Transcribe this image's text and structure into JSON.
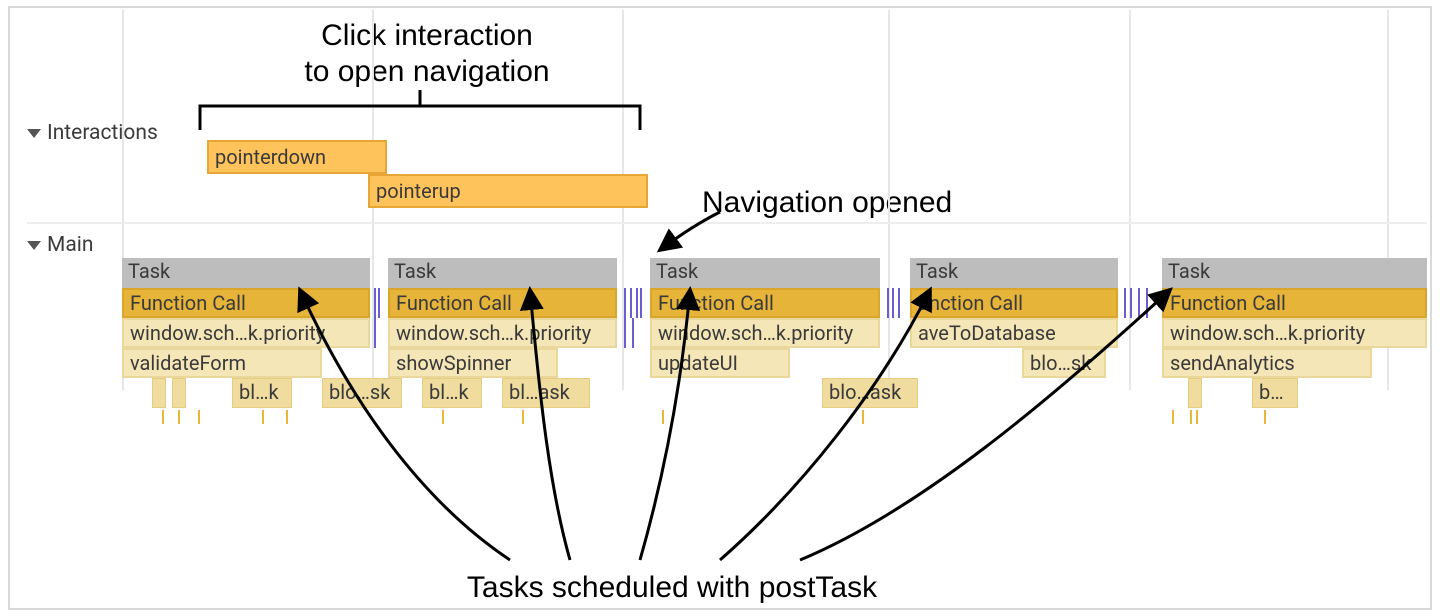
{
  "tracks": {
    "interactions_label": "Interactions",
    "main_label": "Main"
  },
  "interactions": {
    "row0": {
      "label": "pointerdown"
    },
    "row1": {
      "label": "pointerup"
    }
  },
  "main": {
    "columns": [
      {
        "task": "Task",
        "func": "Function Call",
        "sched": "window.sch…k.priority",
        "fn": "validateForm",
        "micro": [
          "bl…k",
          "blo…sk"
        ]
      },
      {
        "task": "Task",
        "func": "Function Call",
        "sched": "window.sch…k.priority",
        "fn": "showSpinner",
        "micro": [
          "bl…k",
          "bl…ask"
        ]
      },
      {
        "task": "Task",
        "func": "Function Call",
        "sched": "window.sch…k.priority",
        "fn": "updateUI",
        "micro": [
          "blo…ask"
        ]
      },
      {
        "task": "Task",
        "func": "unction Call",
        "sched": "aveToDatabase",
        "fn": "",
        "micro": [
          "blo…sk"
        ]
      },
      {
        "task": "Task",
        "func": "Function Call",
        "sched": "window.sch…k.priority",
        "fn": "sendAnalytics",
        "micro": [
          "b…"
        ]
      }
    ]
  },
  "annotations": {
    "top": "Click interaction\nto open navigation",
    "right": "Navigation opened",
    "bottom": "Tasks scheduled with postTask"
  }
}
